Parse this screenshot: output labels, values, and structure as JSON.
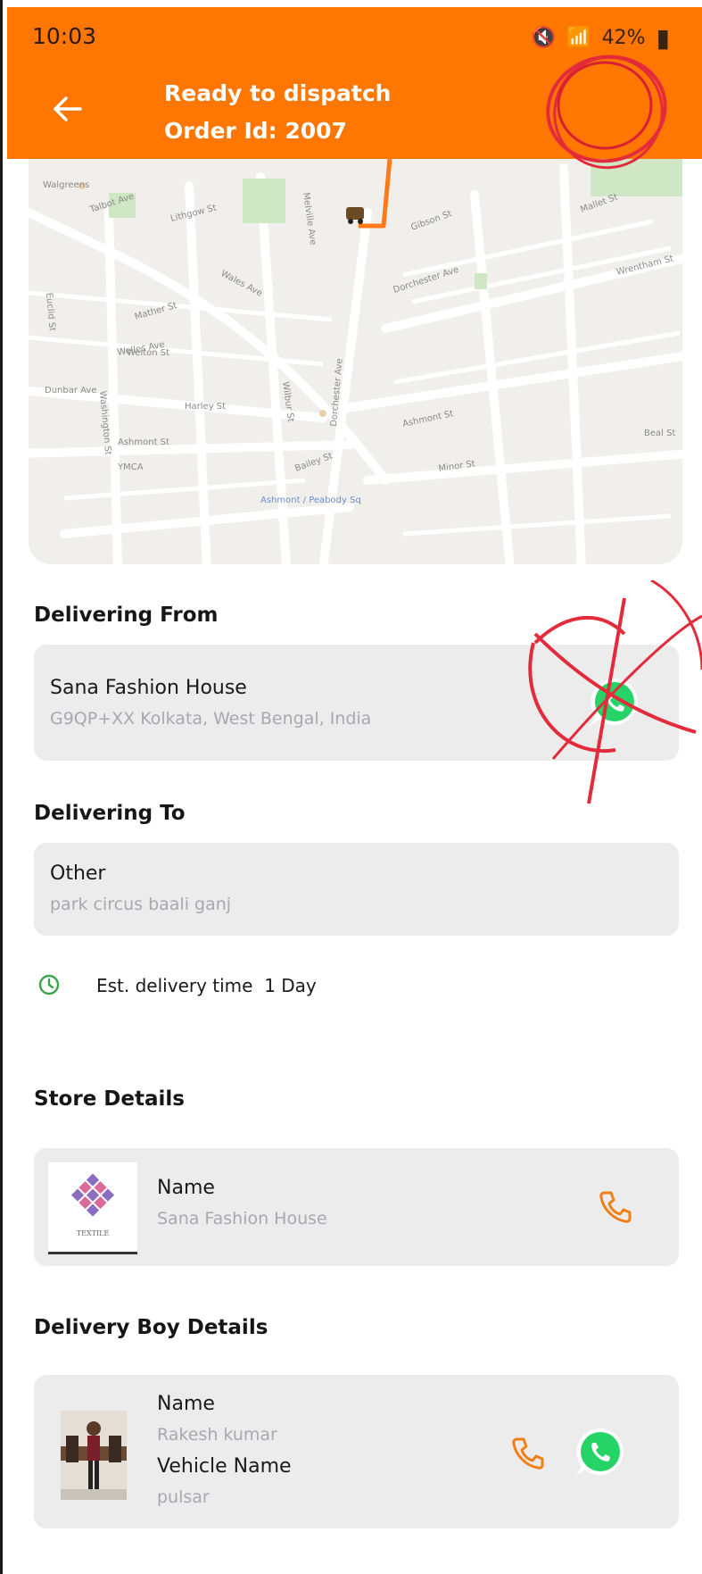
{
  "status_bar": {
    "time": "10:03",
    "battery": "42%"
  },
  "header": {
    "title": "Ready to dispatch",
    "order_id": "Order Id: 2007"
  },
  "map": {
    "attribution": "Ashmont / Peabody Sq",
    "labels": [
      "Walgreens",
      "Talbot Ave",
      "Lithgow St",
      "Wales Ave",
      "Mather St",
      "Dorchester Ave",
      "Ashmont St",
      "YMCA",
      "Mallet St",
      "Wrentham St",
      "Gibson St",
      "Welles Ave",
      "Harley St",
      "Minor St",
      "Dunbar Ave",
      "Wilbur St",
      "Welton St",
      "Washington St",
      "Melville Ave",
      "Bailey St",
      "Ashmont St",
      "Dorchester Ave",
      "Euclid St",
      "Beal St"
    ]
  },
  "delivering_from": {
    "heading": "Delivering From",
    "name": "Sana Fashion House",
    "address": "G9QP+XX Kolkata, West Bengal, India"
  },
  "delivering_to": {
    "heading": "Delivering To",
    "name": "Other",
    "address": "park circus baali ganj"
  },
  "eta": {
    "label": "Est. delivery time",
    "value": "1 Day"
  },
  "store_details": {
    "heading": "Store Details",
    "name_label": "Name",
    "name_value": "Sana Fashion House",
    "logo_text": "TEXTILE"
  },
  "delivery_boy": {
    "heading": "Delivery Boy Details",
    "name_label": "Name",
    "name_value": "Rakesh kumar",
    "vehicle_label": "Vehicle Name",
    "vehicle_value": "pulsar"
  },
  "colors": {
    "accent": "#ff7600",
    "card_bg": "#ececec",
    "subtext": "#a8a8b0",
    "whatsapp": "#25d366"
  }
}
